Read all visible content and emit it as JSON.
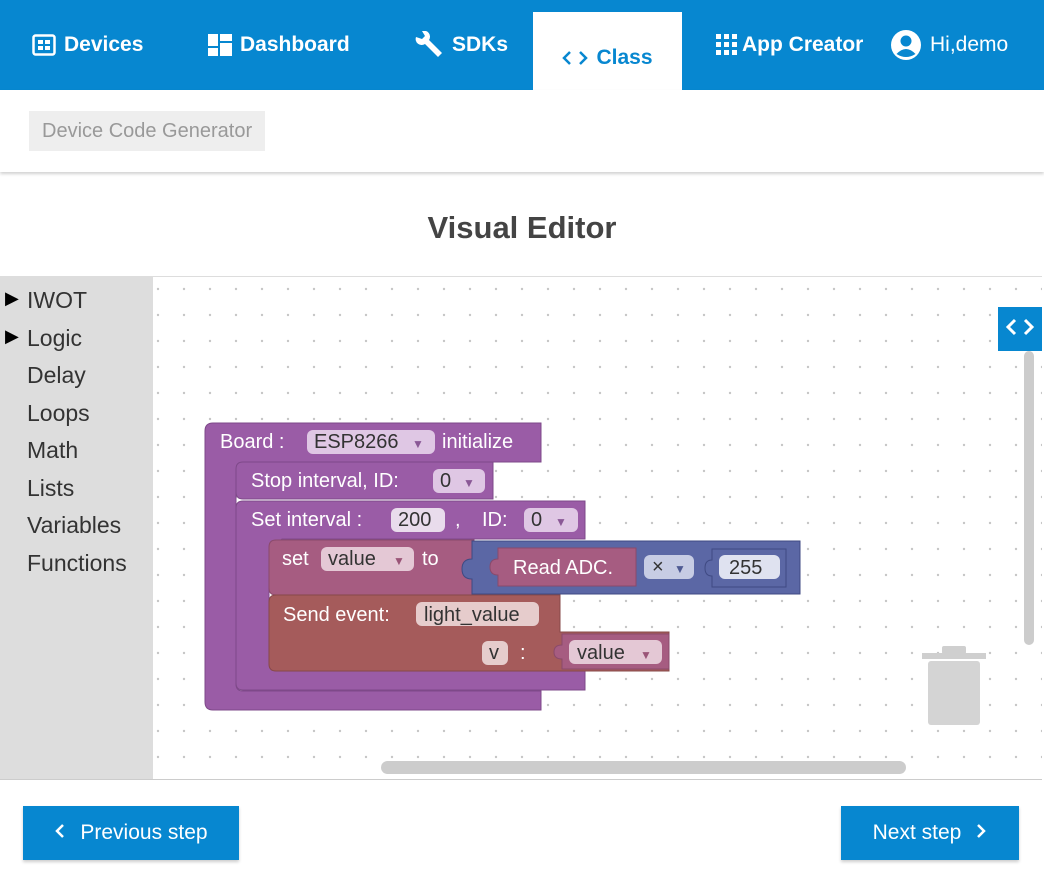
{
  "nav": {
    "devices": "Devices",
    "dashboard": "Dashboard",
    "sdks": "SDKs",
    "class": "Class",
    "app_creator": "App Creator",
    "user": "Hi,demo"
  },
  "breadcrumb": "Device Code Generator",
  "title": "Visual Editor",
  "toolbox": {
    "categories": [
      {
        "label": "IWOT",
        "expandable": true
      },
      {
        "label": "Logic",
        "expandable": true
      },
      {
        "label": "Delay",
        "expandable": false
      },
      {
        "label": "Loops",
        "expandable": false
      },
      {
        "label": "Math",
        "expandable": false
      },
      {
        "label": "Lists",
        "expandable": false
      },
      {
        "label": "Variables",
        "expandable": false
      },
      {
        "label": "Functions",
        "expandable": false
      }
    ]
  },
  "blocks": {
    "board_label": "Board :",
    "board_value": "ESP8266",
    "initialize": "initialize",
    "stop_label": "Stop interval, ID:",
    "stop_id": "0",
    "set_interval_label": "Set interval :",
    "interval_value": "200",
    "comma": ",",
    "id_label": "ID:",
    "interval_id": "0",
    "set_label": "set",
    "var_name": "value",
    "to_label": "to",
    "read_adc": "Read ADC.",
    "operator": "×",
    "multiplier": "255",
    "send_event_label": "Send event:",
    "event_name": "light_value",
    "param_key": "v",
    "colon": ":",
    "param_value": "value"
  },
  "colors": {
    "primary": "#0787d0",
    "block_purple": "#9a5ca6",
    "block_rose": "#a65c81",
    "block_brown": "#a55b5b",
    "block_blue": "#5b67a5"
  },
  "buttons": {
    "previous": "Previous step",
    "next": "Next step"
  }
}
